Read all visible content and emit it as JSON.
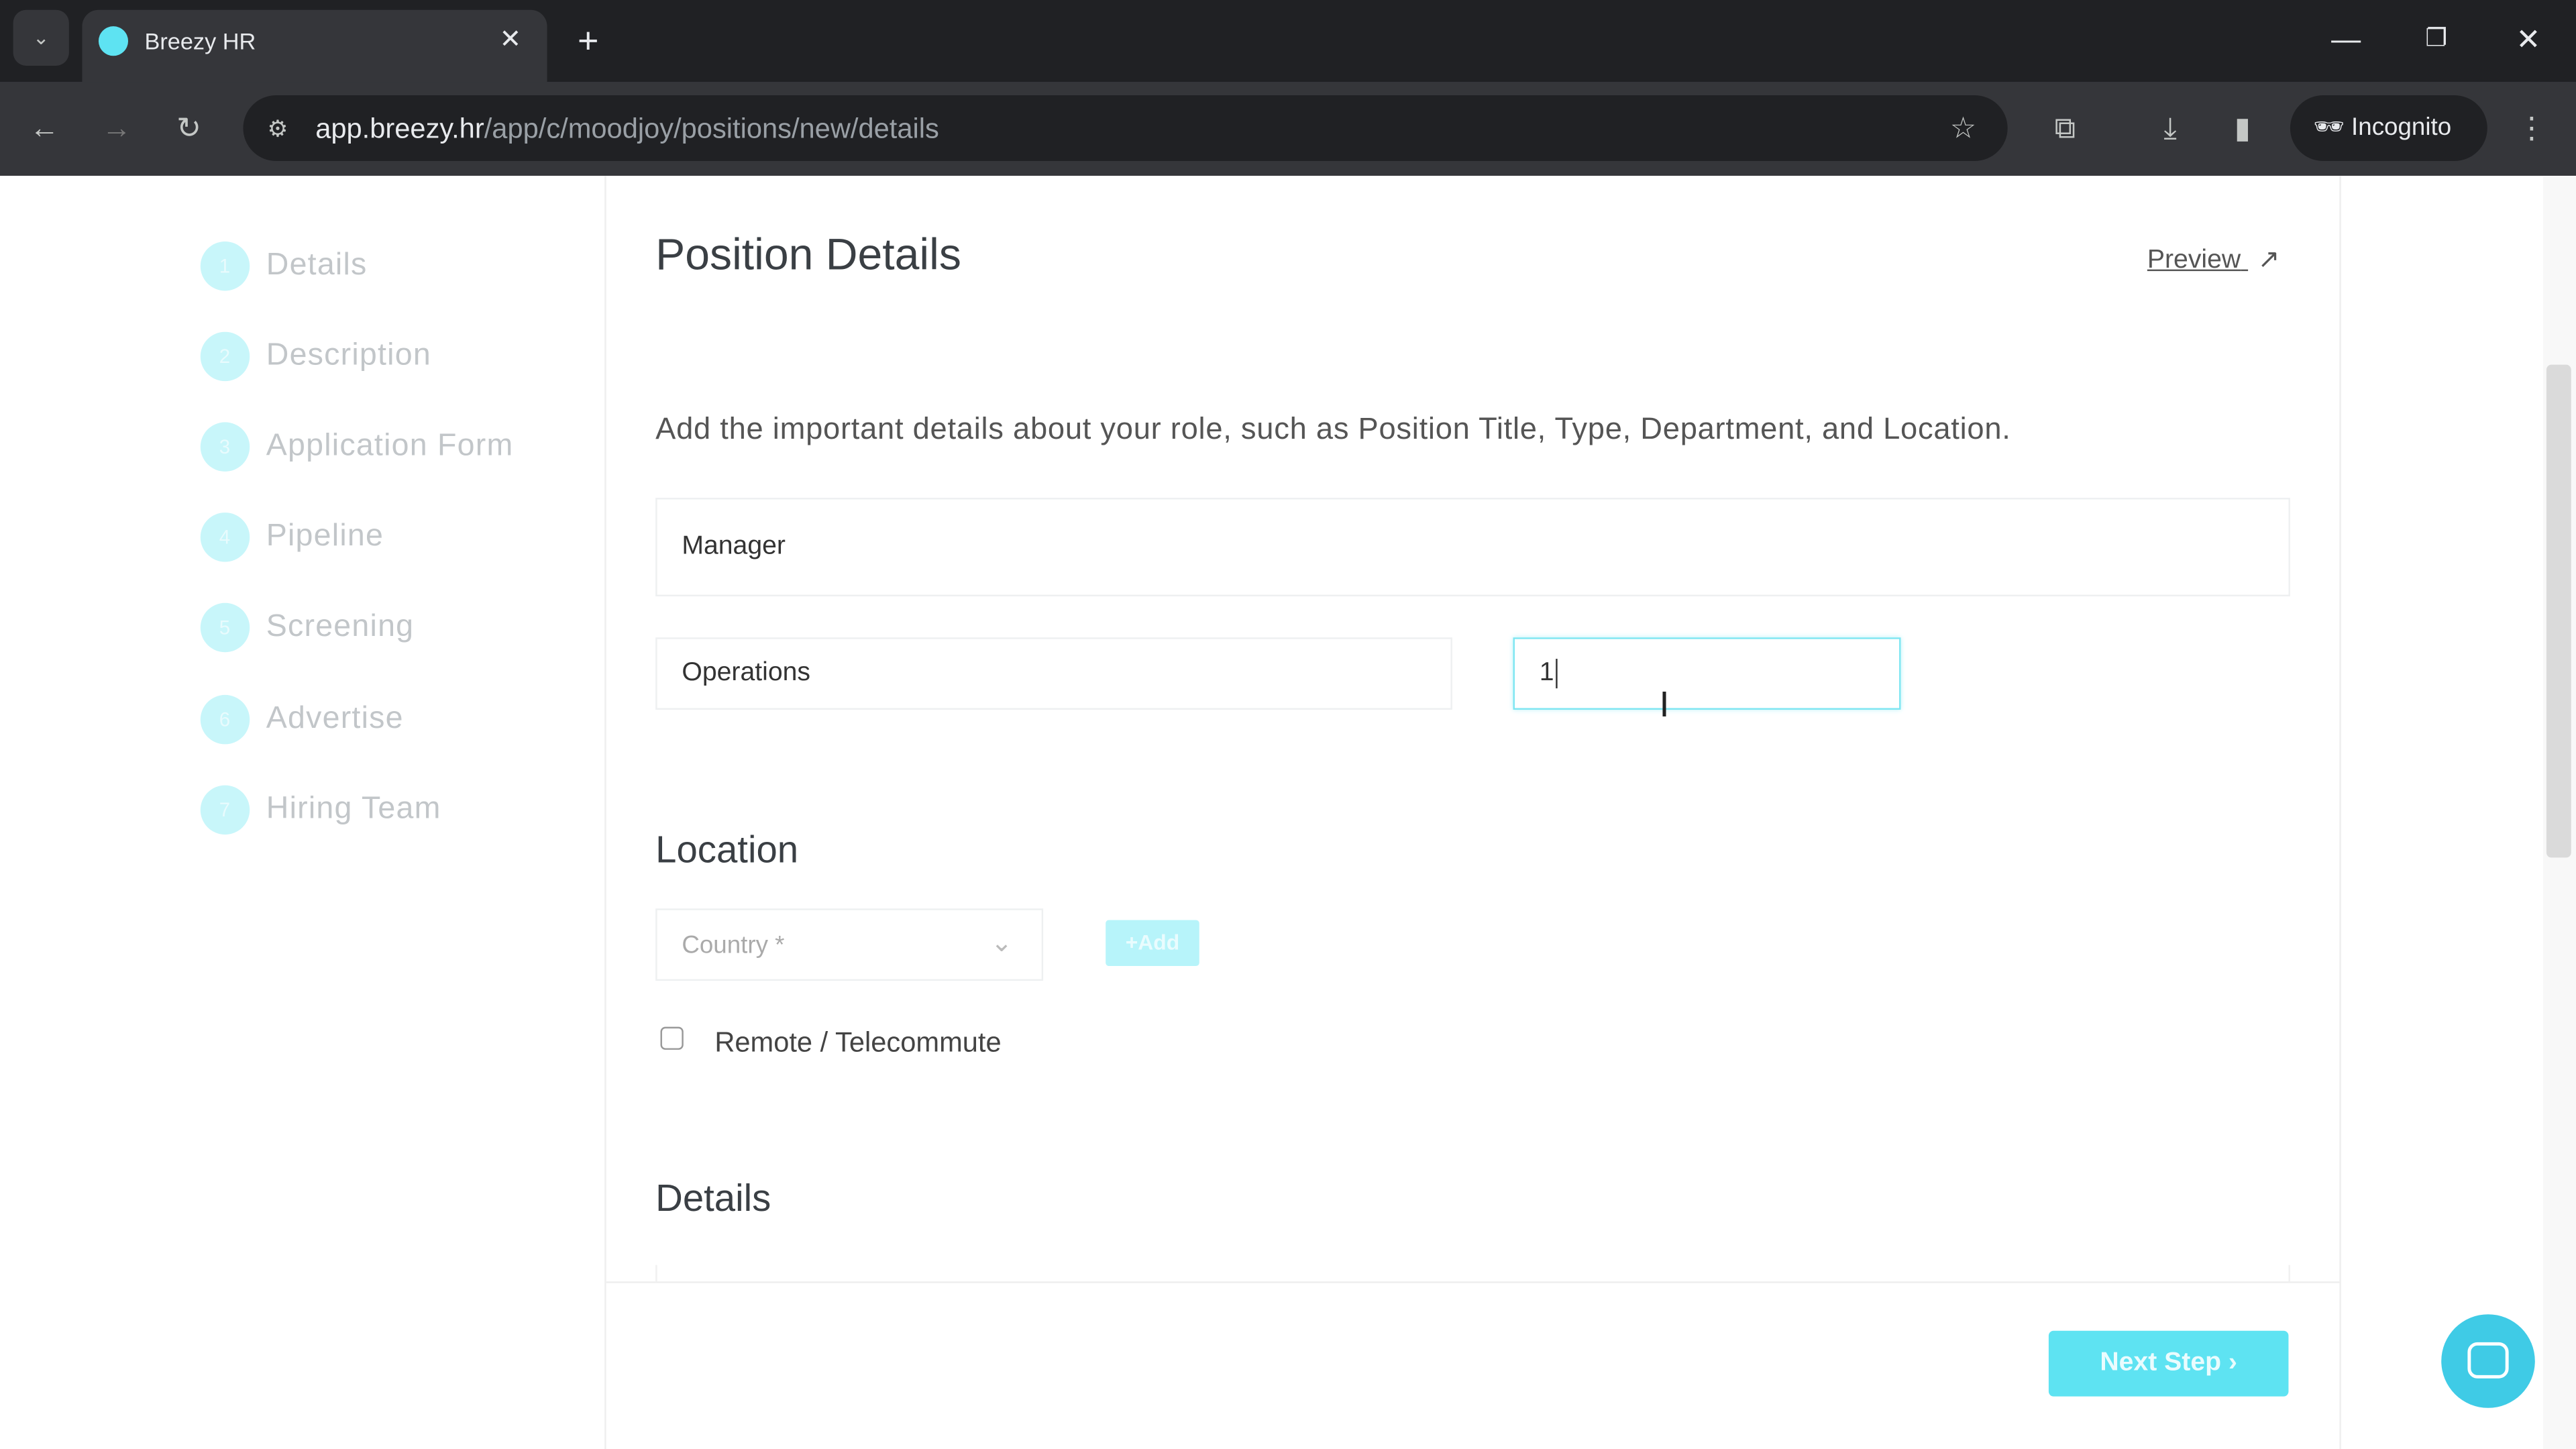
{
  "browser": {
    "tab_title": "Breezy HR",
    "url_host": "app.breezy.hr",
    "url_path": "/app/c/moodjoy/positions/new/details",
    "incognito_label": "Incognito"
  },
  "sidebar": {
    "steps": [
      {
        "n": "1",
        "label": "Details"
      },
      {
        "n": "2",
        "label": "Description"
      },
      {
        "n": "3",
        "label": "Application Form"
      },
      {
        "n": "4",
        "label": "Pipeline"
      },
      {
        "n": "5",
        "label": "Screening"
      },
      {
        "n": "6",
        "label": "Advertise"
      },
      {
        "n": "7",
        "label": "Hiring Team"
      }
    ]
  },
  "main": {
    "title": "Position Details",
    "preview_label": "Preview",
    "intro": "Add the important details about your role, such as Position Title, Type, Department, and Location.",
    "position_title_value": "Manager",
    "department_value": "Operations",
    "third_value": "1",
    "location_heading": "Location",
    "country_placeholder": "Country *",
    "add_label": "+Add",
    "remote_label": "Remote / Telecommute",
    "details_heading": "Details",
    "next_label": "Next Step"
  },
  "colors": {
    "accent": "#5ee3f2",
    "chat": "#3fcbe6"
  }
}
